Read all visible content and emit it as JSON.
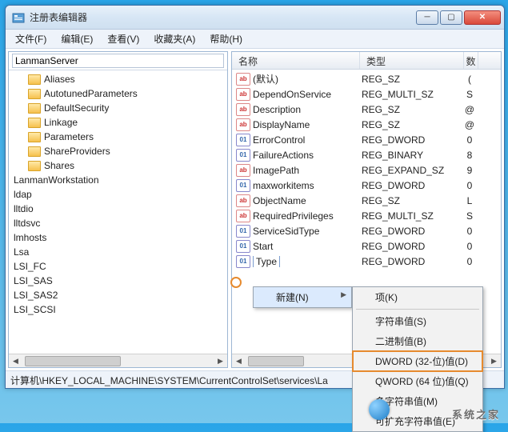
{
  "window": {
    "title": "注册表编辑器"
  },
  "menu": {
    "file": "文件(F)",
    "edit": "编辑(E)",
    "view": "查看(V)",
    "fav": "收藏夹(A)",
    "help": "帮助(H)"
  },
  "tree": {
    "search_value": "LanmanServer",
    "items": [
      {
        "label": "Aliases",
        "folder": true,
        "indent": true
      },
      {
        "label": "AutotunedParameters",
        "folder": true,
        "indent": true
      },
      {
        "label": "DefaultSecurity",
        "folder": true,
        "indent": true
      },
      {
        "label": "Linkage",
        "folder": true,
        "indent": true
      },
      {
        "label": "Parameters",
        "folder": true,
        "indent": true
      },
      {
        "label": "ShareProviders",
        "folder": true,
        "indent": true
      },
      {
        "label": "Shares",
        "folder": true,
        "indent": true
      },
      {
        "label": "LanmanWorkstation",
        "folder": false,
        "indent": false
      },
      {
        "label": "ldap",
        "folder": false,
        "indent": false
      },
      {
        "label": "lltdio",
        "folder": false,
        "indent": false
      },
      {
        "label": "lltdsvc",
        "folder": false,
        "indent": false
      },
      {
        "label": "lmhosts",
        "folder": false,
        "indent": false
      },
      {
        "label": "Lsa",
        "folder": false,
        "indent": false
      },
      {
        "label": "LSI_FC",
        "folder": false,
        "indent": false
      },
      {
        "label": "LSI_SAS",
        "folder": false,
        "indent": false
      },
      {
        "label": "LSI_SAS2",
        "folder": false,
        "indent": false
      },
      {
        "label": "LSI_SCSI",
        "folder": false,
        "indent": false
      }
    ]
  },
  "list": {
    "cols": {
      "name": "名称",
      "type": "类型",
      "extra": "数"
    },
    "rows": [
      {
        "name": "(默认)",
        "type": "REG_SZ",
        "d": "(",
        "icon": "str"
      },
      {
        "name": "DependOnService",
        "type": "REG_MULTI_SZ",
        "d": "S",
        "icon": "str"
      },
      {
        "name": "Description",
        "type": "REG_SZ",
        "d": "@",
        "icon": "str"
      },
      {
        "name": "DisplayName",
        "type": "REG_SZ",
        "d": "@",
        "icon": "str"
      },
      {
        "name": "ErrorControl",
        "type": "REG_DWORD",
        "d": "0",
        "icon": "bin"
      },
      {
        "name": "FailureActions",
        "type": "REG_BINARY",
        "d": "8",
        "icon": "bin"
      },
      {
        "name": "ImagePath",
        "type": "REG_EXPAND_SZ",
        "d": "9",
        "icon": "str"
      },
      {
        "name": "maxworkitems",
        "type": "REG_DWORD",
        "d": "0",
        "icon": "bin"
      },
      {
        "name": "ObjectName",
        "type": "REG_SZ",
        "d": "L",
        "icon": "str"
      },
      {
        "name": "RequiredPrivileges",
        "type": "REG_MULTI_SZ",
        "d": "S",
        "icon": "str"
      },
      {
        "name": "ServiceSidType",
        "type": "REG_DWORD",
        "d": "0",
        "icon": "bin"
      },
      {
        "name": "Start",
        "type": "REG_DWORD",
        "d": "0",
        "icon": "bin"
      },
      {
        "name": "Type",
        "type": "REG_DWORD",
        "d": "0",
        "icon": "bin",
        "editing": true
      }
    ]
  },
  "statusbar": "计算机\\HKEY_LOCAL_MACHINE\\SYSTEM\\CurrentControlSet\\services\\La",
  "context1": {
    "new": "新建(N)"
  },
  "context2": {
    "key": "项(K)",
    "string": "字符串值(S)",
    "binary": "二进制值(B)",
    "dword": "DWORD (32-位)值(D)",
    "qword": "QWORD (64 位)值(Q)",
    "multi": "多字符串值(M)",
    "expand": "可扩充字符串值(E)"
  },
  "watermark": "系统之家"
}
